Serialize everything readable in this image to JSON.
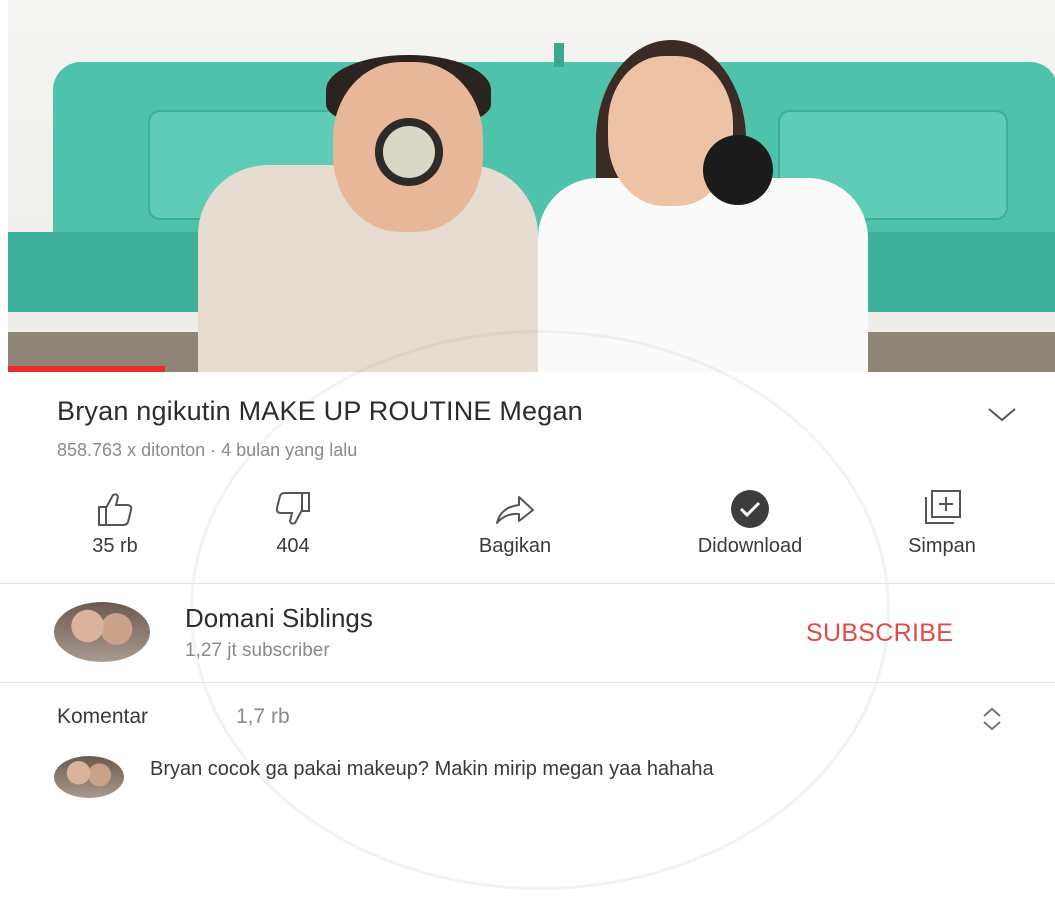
{
  "video": {
    "progress_fraction": 0.15
  },
  "info": {
    "title": "Bryan ngikutin MAKE UP ROUTINE Megan",
    "meta": "858.763 x ditonton · 4 bulan yang lalu",
    "expand_icon": "chevron-down-icon"
  },
  "actions": [
    {
      "icon": "thumbs-up-icon",
      "label": "35 rb"
    },
    {
      "icon": "thumbs-down-icon",
      "label": "404"
    },
    {
      "icon": "share-icon",
      "label": "Bagikan"
    },
    {
      "icon": "downloaded-check-icon",
      "label": "Didownload"
    },
    {
      "icon": "add-to-playlist-icon",
      "label": "Simpan"
    }
  ],
  "channel": {
    "name": "Domani Siblings",
    "subscribers": "1,27 jt subscriber",
    "subscribe_label": "SUBSCRIBE"
  },
  "comments": {
    "label": "Komentar",
    "count": "1,7 rb",
    "sort_icon": "expand-collapse-icon",
    "top_comment": "Bryan cocok ga pakai makeup? Makin mirip megan yaa hahaha"
  },
  "colors": {
    "accent_red": "#e24a46",
    "progress_red": "#ee2b2b",
    "secondary_text": "#8a8a8a"
  }
}
